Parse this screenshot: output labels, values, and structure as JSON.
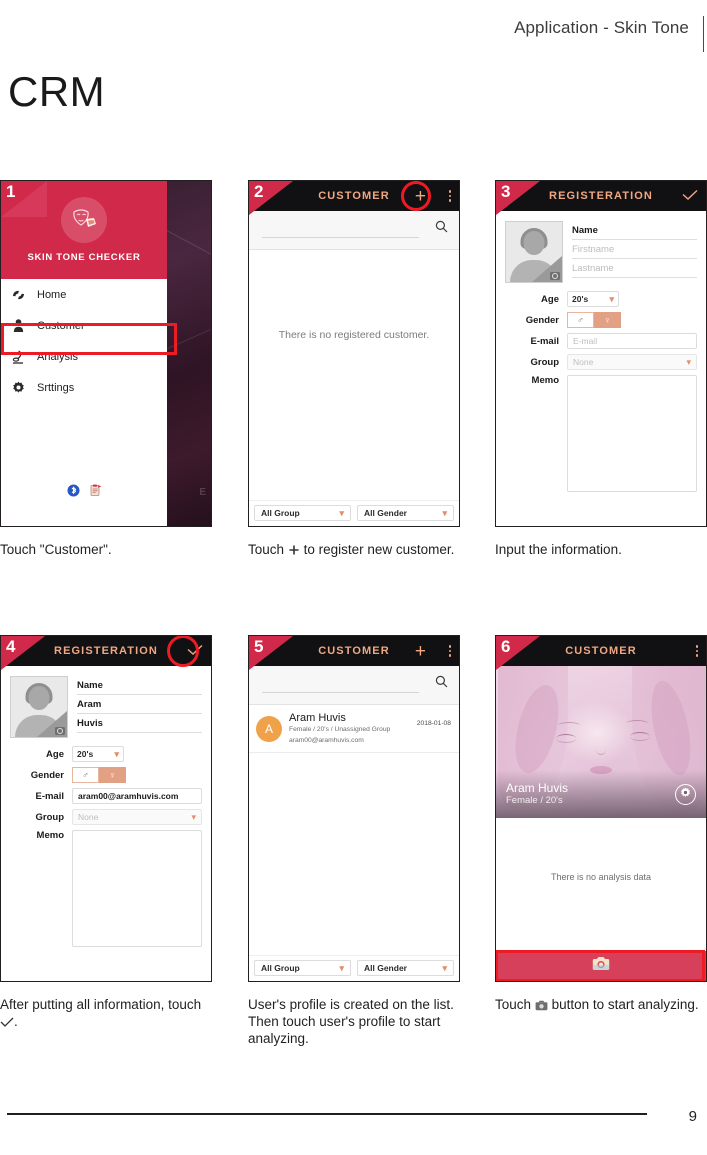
{
  "header": {
    "title": "Application - Skin Tone",
    "page_title": "CRM"
  },
  "footer": {
    "page_number": "9"
  },
  "steps": [
    {
      "number": "1",
      "caption": "Touch \"Customer\".",
      "screen": "drawer",
      "drawer": {
        "brand": "SKIN TONE CHECKER",
        "logo_icon": "face-palette-icon",
        "items": [
          {
            "label": "Home",
            "icon": "home-icon"
          },
          {
            "label": "Customer",
            "icon": "person-icon",
            "highlighted": true
          },
          {
            "label": "Analysis",
            "icon": "microscope-icon"
          },
          {
            "label": "Srttings",
            "icon": "gear-icon"
          }
        ],
        "bottom_icons": [
          "bluetooth-icon",
          "clipboard-icon"
        ],
        "wallpaper_text": "E"
      }
    },
    {
      "number": "2",
      "caption_parts": {
        "before": "Touch",
        "icon": "plus-icon",
        "after": "to register new customer."
      },
      "screen": "customer-empty",
      "appbar": {
        "title": "CUSTOMER",
        "plus": "+",
        "menu_icon": "kebab-menu-icon",
        "highlight": "plus"
      },
      "search": {
        "icon": "search-icon",
        "value": ""
      },
      "empty_message": "There is no registered customer.",
      "filters": [
        {
          "label": "All Group"
        },
        {
          "label": "All Gender"
        }
      ]
    },
    {
      "number": "3",
      "caption": "Input the information.",
      "screen": "registration",
      "appbar": {
        "title": "REGISTERATION",
        "confirm_icon": "check-icon"
      },
      "form": {
        "avatar_icon": "avatar-placeholder-icon",
        "avatar_camera_icon": "camera-icon",
        "name_label": "Name",
        "firstname": "Firstname",
        "lastname": "Lastname",
        "firstname_filled": false,
        "lastname_filled": false,
        "age_label": "Age",
        "age_value": "20's",
        "gender_label": "Gender",
        "gender_male_icon": "♂",
        "gender_female_icon": "♀",
        "gender_selected": "female",
        "email_label": "E-mail",
        "email_value": "E-mail",
        "email_filled": false,
        "group_label": "Group",
        "group_value": "None",
        "memo_label": "Memo",
        "memo_value": ""
      }
    },
    {
      "number": "4",
      "caption_parts": {
        "before": "After putting all information, touch",
        "icon": "check-icon",
        "after": "."
      },
      "screen": "registration",
      "appbar": {
        "title": "REGISTERATION",
        "confirm_icon": "check-icon",
        "highlight": "confirm"
      },
      "form": {
        "avatar_icon": "avatar-placeholder-icon",
        "avatar_camera_icon": "camera-icon",
        "name_label": "Name",
        "firstname": "Aram",
        "lastname": "Huvis",
        "firstname_filled": true,
        "lastname_filled": true,
        "age_label": "Age",
        "age_value": "20's",
        "gender_label": "Gender",
        "gender_male_icon": "♂",
        "gender_female_icon": "♀",
        "gender_selected": "female",
        "email_label": "E-mail",
        "email_value": "aram00@aramhuvis.com",
        "email_filled": true,
        "group_label": "Group",
        "group_value": "None",
        "memo_label": "Memo",
        "memo_value": ""
      }
    },
    {
      "number": "5",
      "caption": "User's profile is created on the list. Then touch user's profile to start analyzing.",
      "screen": "customer-list",
      "appbar": {
        "title": "CUSTOMER",
        "plus": "+",
        "menu_icon": "kebab-menu-icon"
      },
      "search": {
        "icon": "search-icon",
        "value": ""
      },
      "rows": [
        {
          "avatar_letter": "A",
          "name": "Aram Huvis",
          "meta": "Female / 20's / Unassigned Group",
          "email": "aram00@aramhuvis.com",
          "date": "2018-01-08"
        }
      ],
      "filters": [
        {
          "label": "All Group"
        },
        {
          "label": "All Gender"
        }
      ]
    },
    {
      "number": "6",
      "caption_parts": {
        "before": "Touch",
        "icon": "camera-icon",
        "after": "button to start analyzing."
      },
      "screen": "profile",
      "appbar": {
        "title": "CUSTOMER",
        "menu_icon": "kebab-menu-icon"
      },
      "hero": {
        "name": "Aram Huvis",
        "sub": "Female / 20's",
        "settings_icon": "gear-icon"
      },
      "empty_message": "There is no analysis data",
      "camera_button": {
        "icon": "camera-icon",
        "highlighted": true
      }
    }
  ],
  "colors": {
    "brand_red": "#d1294a",
    "highlight_red": "#ed1c24",
    "appbar_bg": "#111012",
    "appbar_text": "#f0a883",
    "accent_salmon": "#e2a184",
    "avatar_orange": "#f0a24b",
    "camera_bar": "#d6405a"
  }
}
